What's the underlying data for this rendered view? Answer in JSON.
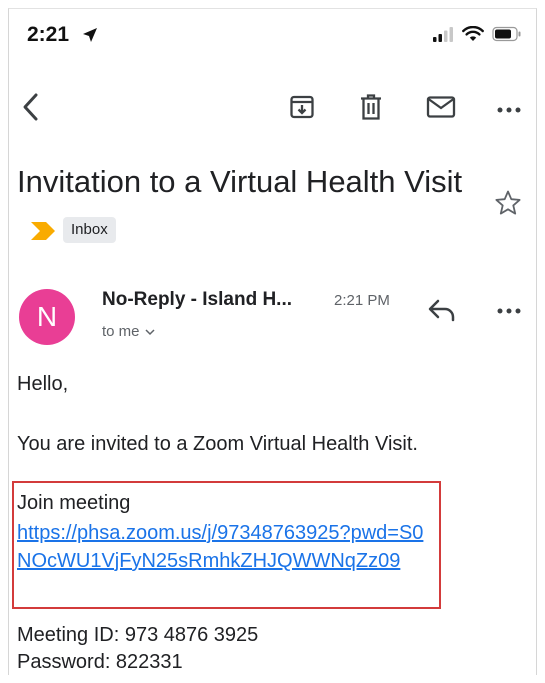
{
  "status_bar": {
    "time": "2:21"
  },
  "toolbar": {
    "back_icon": "chevron-left",
    "archive_icon": "archive",
    "delete_icon": "trash",
    "mark_unread_icon": "envelope",
    "more_icon": "more-horizontal"
  },
  "email": {
    "subject": "Invitation to a Virtual Health Visit",
    "label": "Inbox",
    "sender": "No-Reply - Island H...",
    "sender_initial": "N",
    "time": "2:21 PM",
    "recipient": "to me",
    "greeting": "Hello,",
    "intro": "You are invited to a Zoom Virtual Health Visit.",
    "join_label": "Join meeting",
    "join_link": "https://phsa.zoom.us/j/97348763925?pwd=S0NOcWU1VjFyN25sRmhkZHJQWWNqZz09",
    "meeting_id": "Meeting ID: 973 4876 3925",
    "password": "Password: 822331"
  },
  "colors": {
    "avatar": "#e93e95",
    "link": "#1a73e8",
    "importance": "#f9ab00",
    "highlight_border": "#d33b3b"
  }
}
